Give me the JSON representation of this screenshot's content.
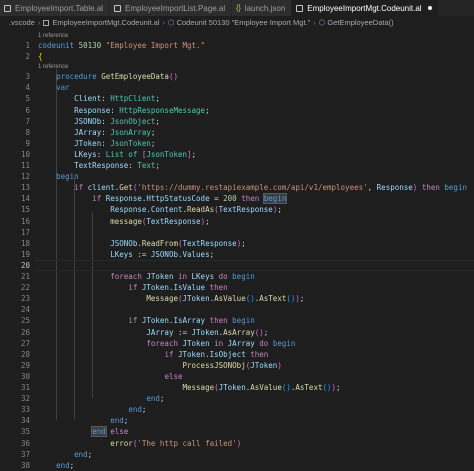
{
  "tabs": [
    {
      "label": "EmployeeImport.Table.al",
      "active": false,
      "icon": "file-icon"
    },
    {
      "label": "EmployeeImportList.Page.al",
      "active": false,
      "icon": "file-icon"
    },
    {
      "label": "launch.json",
      "active": false,
      "icon": "json-icon"
    },
    {
      "label": "EmployeeImportMgt.Codeunit.al",
      "active": true,
      "icon": "file-icon"
    }
  ],
  "breadcrumb": [
    ".vscode",
    "EmployeeImportMgt.Codeunit.al",
    "Codeunit 50130 \"Employee Import Mgt.\"",
    "GetEmployeeData()"
  ],
  "codelens": [
    "1 reference",
    "1 reference"
  ],
  "current_line": 20,
  "lines": [
    {
      "n": "1",
      "t": [
        [
          "k",
          "codeunit"
        ],
        [
          "p",
          " "
        ],
        [
          "n",
          "50130"
        ],
        [
          "p",
          " "
        ],
        [
          "s",
          "\"Employee Import Mgt.\""
        ]
      ]
    },
    {
      "n": "2",
      "t": [
        [
          "g1",
          "{"
        ]
      ]
    },
    {
      "n": "3",
      "t": [
        [
          "p",
          "    "
        ],
        [
          "k",
          "procedure"
        ],
        [
          "p",
          " "
        ],
        [
          "f",
          "GetEmployeeData"
        ],
        [
          "g2",
          "()"
        ]
      ]
    },
    {
      "n": "4",
      "t": [
        [
          "p",
          "    "
        ],
        [
          "k",
          "var"
        ]
      ]
    },
    {
      "n": "5",
      "t": [
        [
          "p",
          "        "
        ],
        [
          "i",
          "Client"
        ],
        [
          "p",
          ": "
        ],
        [
          "t",
          "HttpClient"
        ],
        [
          "p",
          ";"
        ]
      ]
    },
    {
      "n": "6",
      "t": [
        [
          "p",
          "        "
        ],
        [
          "i",
          "Response"
        ],
        [
          "p",
          ": "
        ],
        [
          "t",
          "HttpResponseMessage"
        ],
        [
          "p",
          ";"
        ]
      ]
    },
    {
      "n": "7",
      "t": [
        [
          "p",
          "        "
        ],
        [
          "i",
          "JSONOb"
        ],
        [
          "p",
          ": "
        ],
        [
          "t",
          "JsonObject"
        ],
        [
          "p",
          ";"
        ]
      ]
    },
    {
      "n": "8",
      "t": [
        [
          "p",
          "        "
        ],
        [
          "i",
          "JArray"
        ],
        [
          "p",
          ": "
        ],
        [
          "t",
          "JsonArray"
        ],
        [
          "p",
          ";"
        ]
      ]
    },
    {
      "n": "9",
      "t": [
        [
          "p",
          "        "
        ],
        [
          "i",
          "JToken"
        ],
        [
          "p",
          ": "
        ],
        [
          "t",
          "JsonToken"
        ],
        [
          "p",
          ";"
        ]
      ]
    },
    {
      "n": "10",
      "t": [
        [
          "p",
          "        "
        ],
        [
          "i",
          "LKeys"
        ],
        [
          "p",
          ": "
        ],
        [
          "t",
          "List of "
        ],
        [
          "g2",
          "["
        ],
        [
          "t",
          "JsonToken"
        ],
        [
          "g2",
          "]"
        ],
        [
          "p",
          ";"
        ]
      ]
    },
    {
      "n": "11",
      "t": [
        [
          "p",
          "        "
        ],
        [
          "i",
          "TextResponse"
        ],
        [
          "p",
          ": "
        ],
        [
          "t",
          "Text"
        ],
        [
          "p",
          ";"
        ]
      ]
    },
    {
      "n": "12",
      "t": [
        [
          "p",
          "    "
        ],
        [
          "k",
          "begin"
        ]
      ]
    },
    {
      "n": "13",
      "t": [
        [
          "p",
          "        "
        ],
        [
          "c",
          "if"
        ],
        [
          "p",
          " "
        ],
        [
          "i",
          "client"
        ],
        [
          "p",
          "."
        ],
        [
          "f",
          "Get"
        ],
        [
          "g2",
          "("
        ],
        [
          "s",
          "'https://dummy.restapiexample.com/api/v1/employees'"
        ],
        [
          "p",
          ", "
        ],
        [
          "i",
          "Response"
        ],
        [
          "g2",
          ")"
        ],
        [
          "p",
          " "
        ],
        [
          "c",
          "then"
        ],
        [
          "p",
          " "
        ],
        [
          "k",
          "begin"
        ]
      ]
    },
    {
      "n": "14",
      "t": [
        [
          "p",
          "            "
        ],
        [
          "c",
          "if"
        ],
        [
          "p",
          " "
        ],
        [
          "i",
          "Response"
        ],
        [
          "p",
          "."
        ],
        [
          "i",
          "HttpStatusCode"
        ],
        [
          "p",
          " = "
        ],
        [
          "n",
          "200"
        ],
        [
          "p",
          " "
        ],
        [
          "c",
          "then"
        ],
        [
          "p",
          " "
        ],
        [
          "k hl",
          "begin"
        ]
      ]
    },
    {
      "n": "15",
      "t": [
        [
          "p",
          "                "
        ],
        [
          "i",
          "Response"
        ],
        [
          "p",
          "."
        ],
        [
          "i",
          "Content"
        ],
        [
          "p",
          "."
        ],
        [
          "f",
          "ReadAs"
        ],
        [
          "g2",
          "("
        ],
        [
          "i",
          "TextResponse"
        ],
        [
          "g2",
          ")"
        ],
        [
          "p",
          ";"
        ]
      ]
    },
    {
      "n": "16",
      "t": [
        [
          "p",
          "                "
        ],
        [
          "f",
          "message"
        ],
        [
          "g2",
          "("
        ],
        [
          "i",
          "TextResponse"
        ],
        [
          "g2",
          ")"
        ],
        [
          "p",
          ";"
        ]
      ]
    },
    {
      "n": "17",
      "t": []
    },
    {
      "n": "18",
      "t": [
        [
          "p",
          "                "
        ],
        [
          "i",
          "JSONOb"
        ],
        [
          "p",
          "."
        ],
        [
          "f",
          "ReadFrom"
        ],
        [
          "g2",
          "("
        ],
        [
          "i",
          "TextResponse"
        ],
        [
          "g2",
          ")"
        ],
        [
          "p",
          ";"
        ]
      ]
    },
    {
      "n": "19",
      "t": [
        [
          "p",
          "                "
        ],
        [
          "i",
          "LKeys"
        ],
        [
          "p",
          " := "
        ],
        [
          "i",
          "JSONOb"
        ],
        [
          "p",
          "."
        ],
        [
          "i",
          "Values"
        ],
        [
          "p",
          ";"
        ]
      ]
    },
    {
      "n": "20",
      "t": []
    },
    {
      "n": "21",
      "t": [
        [
          "p",
          "                "
        ],
        [
          "c",
          "foreach"
        ],
        [
          "p",
          " "
        ],
        [
          "i",
          "JToken"
        ],
        [
          "p",
          " "
        ],
        [
          "c",
          "in"
        ],
        [
          "p",
          " "
        ],
        [
          "i",
          "LKeys"
        ],
        [
          "p",
          " "
        ],
        [
          "c",
          "do"
        ],
        [
          "p",
          " "
        ],
        [
          "k",
          "begin"
        ]
      ]
    },
    {
      "n": "22",
      "t": [
        [
          "p",
          "                    "
        ],
        [
          "c",
          "if"
        ],
        [
          "p",
          " "
        ],
        [
          "i",
          "JToken"
        ],
        [
          "p",
          "."
        ],
        [
          "i",
          "IsValue"
        ],
        [
          "p",
          " "
        ],
        [
          "c",
          "then"
        ]
      ]
    },
    {
      "n": "23",
      "t": [
        [
          "p",
          "                        "
        ],
        [
          "f",
          "Message"
        ],
        [
          "g2",
          "("
        ],
        [
          "i",
          "JToken"
        ],
        [
          "p",
          "."
        ],
        [
          "f",
          "AsValue"
        ],
        [
          "g3",
          "()"
        ],
        [
          "p",
          "."
        ],
        [
          "f",
          "AsText"
        ],
        [
          "g3",
          "()"
        ],
        [
          "g2",
          ")"
        ],
        [
          "p",
          ";"
        ]
      ]
    },
    {
      "n": "24",
      "t": []
    },
    {
      "n": "25",
      "t": [
        [
          "p",
          "                    "
        ],
        [
          "c",
          "if"
        ],
        [
          "p",
          " "
        ],
        [
          "i",
          "JToken"
        ],
        [
          "p",
          "."
        ],
        [
          "i",
          "IsArray"
        ],
        [
          "p",
          " "
        ],
        [
          "c",
          "then"
        ],
        [
          "p",
          " "
        ],
        [
          "k",
          "begin"
        ]
      ]
    },
    {
      "n": "26",
      "t": [
        [
          "p",
          "                        "
        ],
        [
          "i",
          "JArray"
        ],
        [
          "p",
          " := "
        ],
        [
          "i",
          "JToken"
        ],
        [
          "p",
          "."
        ],
        [
          "f",
          "AsArray"
        ],
        [
          "g2",
          "()"
        ],
        [
          "p",
          ";"
        ]
      ]
    },
    {
      "n": "27",
      "t": [
        [
          "p",
          "                        "
        ],
        [
          "c",
          "foreach"
        ],
        [
          "p",
          " "
        ],
        [
          "i",
          "JToken"
        ],
        [
          "p",
          " "
        ],
        [
          "c",
          "in"
        ],
        [
          "p",
          " "
        ],
        [
          "i",
          "JArray"
        ],
        [
          "p",
          " "
        ],
        [
          "c",
          "do"
        ],
        [
          "p",
          " "
        ],
        [
          "k",
          "begin"
        ]
      ]
    },
    {
      "n": "28",
      "t": [
        [
          "p",
          "                            "
        ],
        [
          "c",
          "if"
        ],
        [
          "p",
          " "
        ],
        [
          "i",
          "JToken"
        ],
        [
          "p",
          "."
        ],
        [
          "i",
          "IsObject"
        ],
        [
          "p",
          " "
        ],
        [
          "c",
          "then"
        ]
      ]
    },
    {
      "n": "29",
      "t": [
        [
          "p",
          "                                "
        ],
        [
          "f",
          "ProcessJSONObj"
        ],
        [
          "g2",
          "("
        ],
        [
          "i",
          "JToken"
        ],
        [
          "g2",
          ")"
        ]
      ]
    },
    {
      "n": "30",
      "t": [
        [
          "p",
          "                            "
        ],
        [
          "c",
          "else"
        ]
      ]
    },
    {
      "n": "31",
      "t": [
        [
          "p",
          "                                "
        ],
        [
          "f",
          "Message"
        ],
        [
          "g2",
          "("
        ],
        [
          "i",
          "JToken"
        ],
        [
          "p",
          "."
        ],
        [
          "f",
          "AsValue"
        ],
        [
          "g3",
          "()"
        ],
        [
          "p",
          "."
        ],
        [
          "f",
          "AsText"
        ],
        [
          "g3",
          "()"
        ],
        [
          "g2",
          ")"
        ],
        [
          "p",
          ";"
        ]
      ]
    },
    {
      "n": "32",
      "t": [
        [
          "p",
          "                        "
        ],
        [
          "k",
          "end"
        ],
        [
          "p",
          ";"
        ]
      ]
    },
    {
      "n": "33",
      "t": [
        [
          "p",
          "                    "
        ],
        [
          "k",
          "end"
        ],
        [
          "p",
          ";"
        ]
      ]
    },
    {
      "n": "34",
      "t": [
        [
          "p",
          "                "
        ],
        [
          "k",
          "end"
        ],
        [
          "p",
          ";"
        ]
      ]
    },
    {
      "n": "35",
      "t": [
        [
          "p",
          "            "
        ],
        [
          "k hl",
          "end"
        ],
        [
          "p",
          " "
        ],
        [
          "c",
          "else"
        ]
      ]
    },
    {
      "n": "36",
      "t": [
        [
          "p",
          "                "
        ],
        [
          "f",
          "error"
        ],
        [
          "g2",
          "("
        ],
        [
          "s",
          "'The http call failed'"
        ],
        [
          "g2",
          ")"
        ]
      ]
    },
    {
      "n": "37",
      "t": [
        [
          "p",
          "        "
        ],
        [
          "k",
          "end"
        ],
        [
          "p",
          ";"
        ]
      ]
    },
    {
      "n": "38",
      "t": [
        [
          "p",
          "    "
        ],
        [
          "k",
          "end"
        ],
        [
          "p",
          ";"
        ]
      ]
    }
  ]
}
